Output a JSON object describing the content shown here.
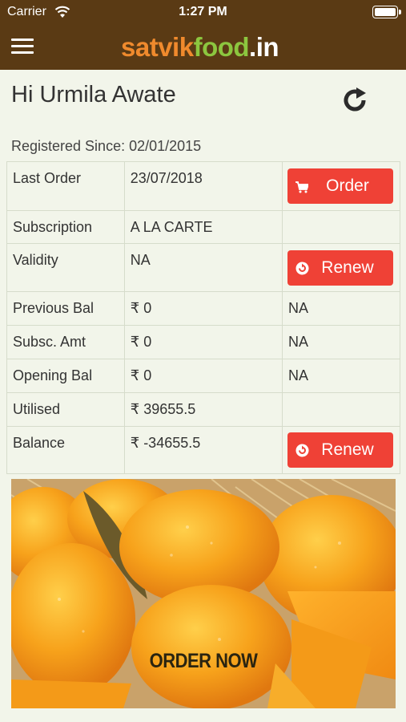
{
  "status_bar": {
    "carrier": "Carrier",
    "time": "1:27 PM"
  },
  "header": {
    "logo_part1": "satvik",
    "logo_part2": "food",
    "logo_part3": ".in",
    "brand_bg": "#5a3a14"
  },
  "greeting": "Hi Urmila Awate",
  "registered_since": "Registered Since: 02/01/2015",
  "account_rows": [
    {
      "label": "Last Order",
      "value": "23/07/2018",
      "action": "Order",
      "action_icon": "cart-icon"
    },
    {
      "label": "Subscription",
      "value": "A LA CARTE",
      "extra": ""
    },
    {
      "label": "Validity",
      "value": "NA",
      "action": "Renew",
      "action_icon": "renew-icon"
    },
    {
      "label": "Previous Bal",
      "value": "₹ 0",
      "extra": "NA"
    },
    {
      "label": "Subsc. Amt",
      "value": "₹ 0",
      "extra": "NA"
    },
    {
      "label": "Opening Bal",
      "value": "₹ 0",
      "extra": "NA"
    },
    {
      "label": "Utilised",
      "value": "₹ 39655.5",
      "extra": ""
    },
    {
      "label": "Balance",
      "value": "₹ -34655.5",
      "action": "Renew",
      "action_icon": "renew-icon"
    }
  ],
  "banner": {
    "text": "ORDER NOW"
  },
  "colors": {
    "accent_button": "#ef4136",
    "background": "#f2f5ea"
  }
}
